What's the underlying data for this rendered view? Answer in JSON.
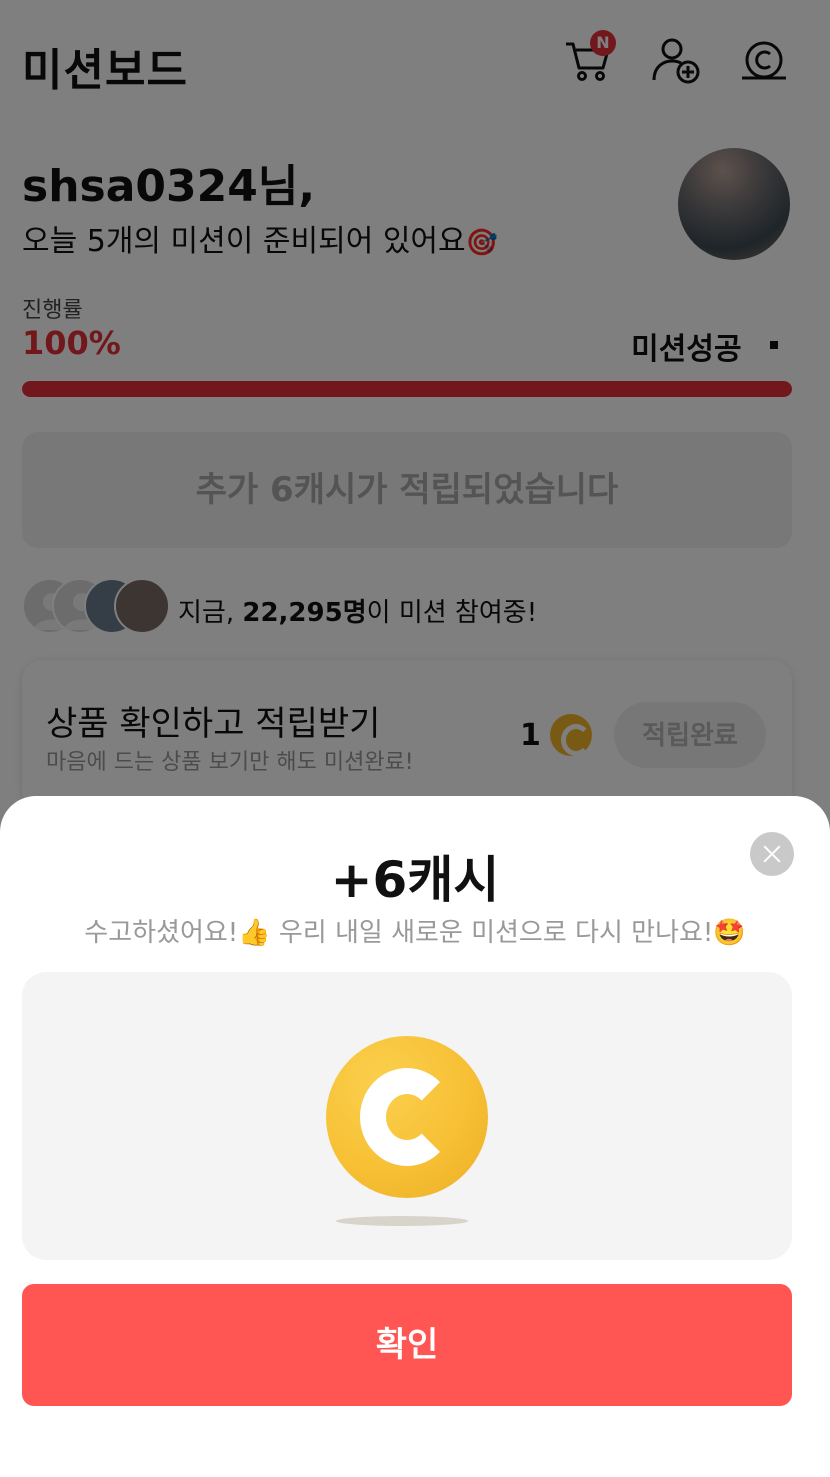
{
  "header": {
    "title": "미션보드",
    "cart_badge": "N",
    "icons": [
      "cart-icon",
      "add-friend-icon",
      "cash-icon"
    ]
  },
  "greeting": {
    "name": "shsa0324님,",
    "message": "오늘 5개의 미션이 준비되어 있어요",
    "message_emoji": "🎯"
  },
  "progress": {
    "label": "진행률",
    "value_text": "100%",
    "value": 1.0,
    "status": "미션성공"
  },
  "notice": {
    "text": "추가 6캐시가 적립되었습니다"
  },
  "participants": {
    "prefix": "지금, ",
    "count": "22,295명",
    "suffix": "이 미션 참여중!"
  },
  "mission": {
    "title": "상품 확인하고 적립받기",
    "subtitle": "마음에 드는 상품 보기만 해도 미션완료!",
    "reward": "1",
    "button": "적립완료"
  },
  "sheet": {
    "title": "+6캐시",
    "message": "수고하셨어요!👍 우리 내일 새로운 미션으로 다시 만나요!🤩",
    "confirm": "확인"
  },
  "colors": {
    "accent": "#e5303a",
    "confirm_button": "#ff5553",
    "coin": "#f7c035"
  }
}
